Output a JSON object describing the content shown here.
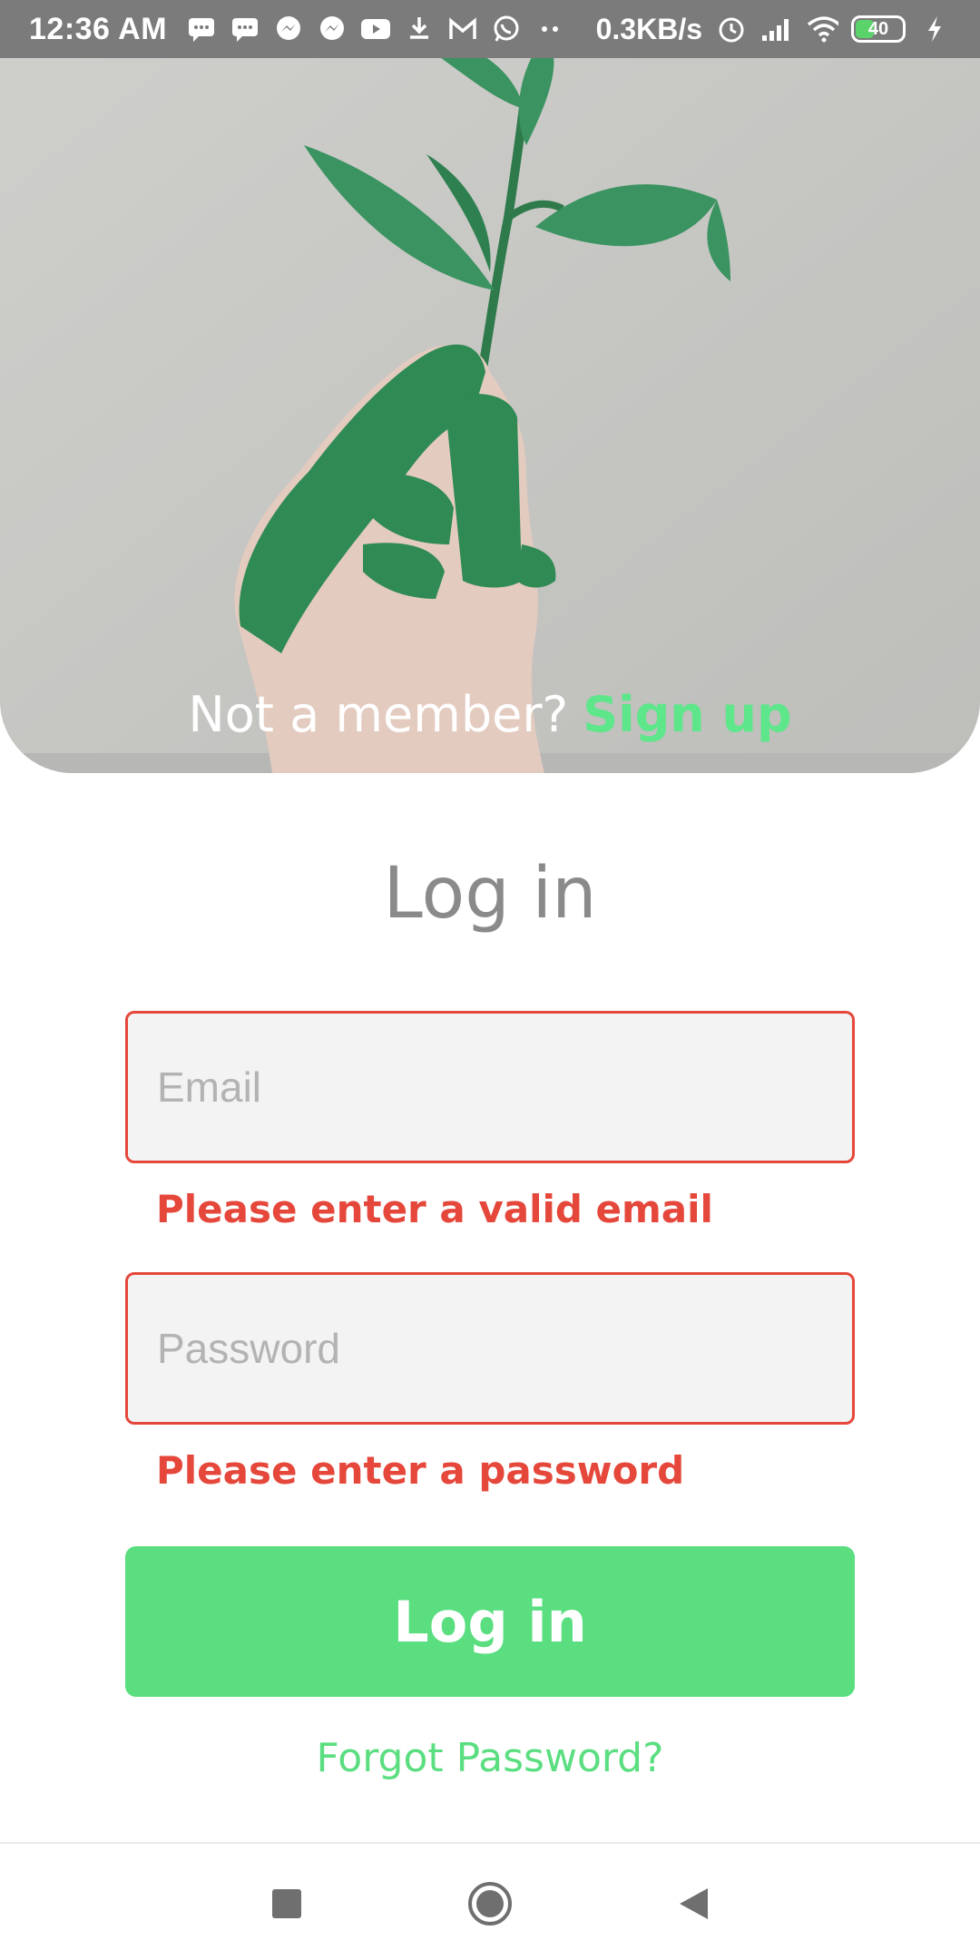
{
  "status_bar": {
    "time": "12:36 AM",
    "net_speed": "0.3KB/s",
    "battery": "40",
    "battery_level": 0.4,
    "icons": [
      "chat-icon",
      "chat-icon",
      "messenger-icon",
      "messenger-icon",
      "youtube-icon",
      "download-icon",
      "gmail-icon",
      "whatsapp-icon",
      "more-dots-icon",
      "alarm-icon",
      "signal-icon",
      "wifi-icon",
      "battery-icon",
      "charging-icon"
    ]
  },
  "hero": {
    "prompt": "Not a member?",
    "signup_link": "Sign up"
  },
  "login": {
    "title": "Log in",
    "email_placeholder": "Email",
    "email_value": "",
    "email_error": "Please enter a valid email",
    "password_placeholder": "Password",
    "password_value": "",
    "password_error": "Please enter a password",
    "submit_label": "Log in",
    "forgot_label": "Forgot Password?"
  },
  "colors": {
    "accent": "#5ade80",
    "error": "#e5473b",
    "title": "#8a8a8a"
  },
  "nav": {
    "buttons": [
      "recents-square-icon",
      "home-circle-icon",
      "back-triangle-icon"
    ]
  }
}
